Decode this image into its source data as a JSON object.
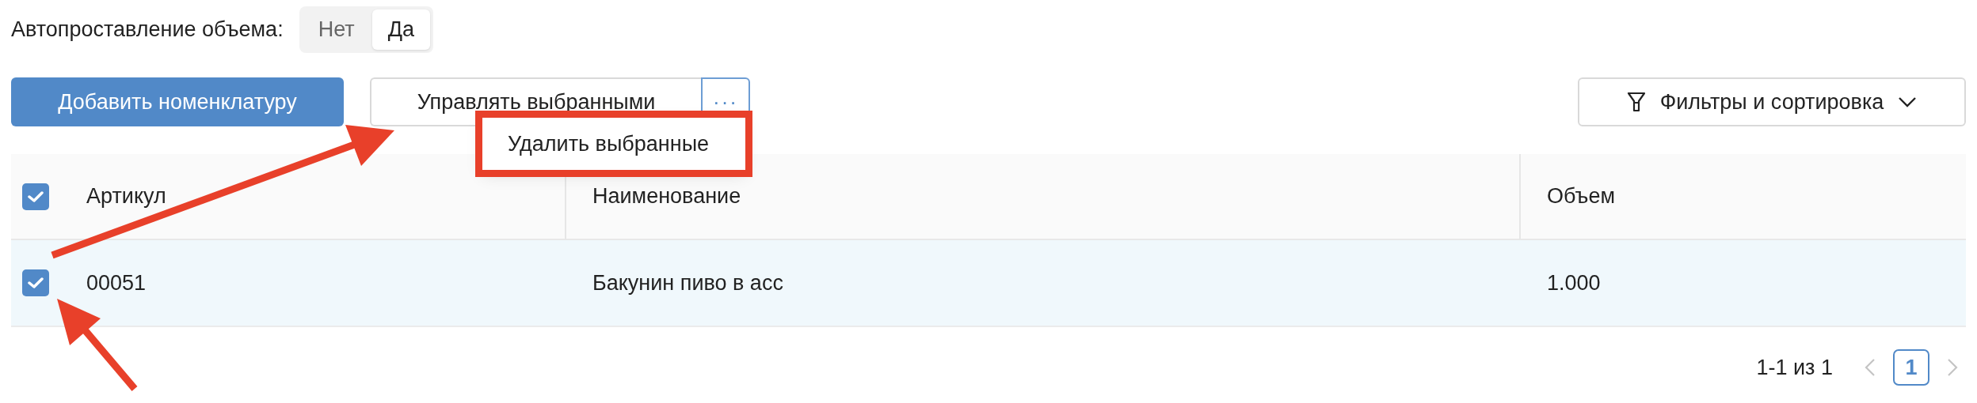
{
  "auto_volume": {
    "label": "Автопроставление объема:",
    "options": [
      {
        "label": "Нет",
        "selected": false
      },
      {
        "label": "Да",
        "selected": true
      }
    ]
  },
  "toolbar": {
    "add_button": "Добавить номенклатуру",
    "manage_button": "Управлять выбранными",
    "more_button": "···",
    "filter_button": "Фильтры и сортировка"
  },
  "dropdown": {
    "items": [
      "Удалить выбранные"
    ]
  },
  "table": {
    "select_all_checked": true,
    "columns": [
      "Артикул",
      "Наименование",
      "Объем"
    ],
    "rows": [
      {
        "checked": true,
        "cells": [
          "00051",
          "Бакунин пиво в асс",
          "1.000"
        ]
      }
    ]
  },
  "pagination": {
    "range": "1-1 из 1",
    "pages": [
      {
        "label": "1",
        "selected": true
      }
    ]
  }
}
